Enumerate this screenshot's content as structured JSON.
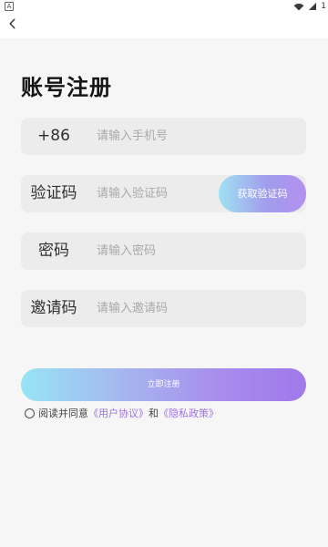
{
  "status_bar": {
    "left_icon": "A",
    "battery_text": "1",
    "wifi_icon": "wifi-icon",
    "signal_icon": "signal-icon"
  },
  "header": {
    "back_icon": "chevron-left-icon",
    "title": "账号注册"
  },
  "form": {
    "phone": {
      "label": "+86",
      "placeholder": "请输入手机号",
      "value": ""
    },
    "verification_code": {
      "label": "验证码",
      "placeholder": "请输入验证码",
      "value": "",
      "button_label": "获取验证码"
    },
    "password": {
      "label": "密码",
      "placeholder": "请输入密码",
      "value": ""
    },
    "invite_code": {
      "label": "邀请码",
      "placeholder": "请输入邀请码",
      "value": ""
    }
  },
  "actions": {
    "submit_label": "立即注册"
  },
  "agreement": {
    "prefix": "阅读并同意",
    "user_agreement": "《用户协议》",
    "conjunction": "和",
    "privacy_policy": "《隐私政策》",
    "checked": false
  },
  "colors": {
    "background": "#f6f6f6",
    "field_background": "#ececec",
    "button_gradient_start": "#97e4f4",
    "button_gradient_end": "#9f79ea",
    "link_color": "#9e73df"
  }
}
